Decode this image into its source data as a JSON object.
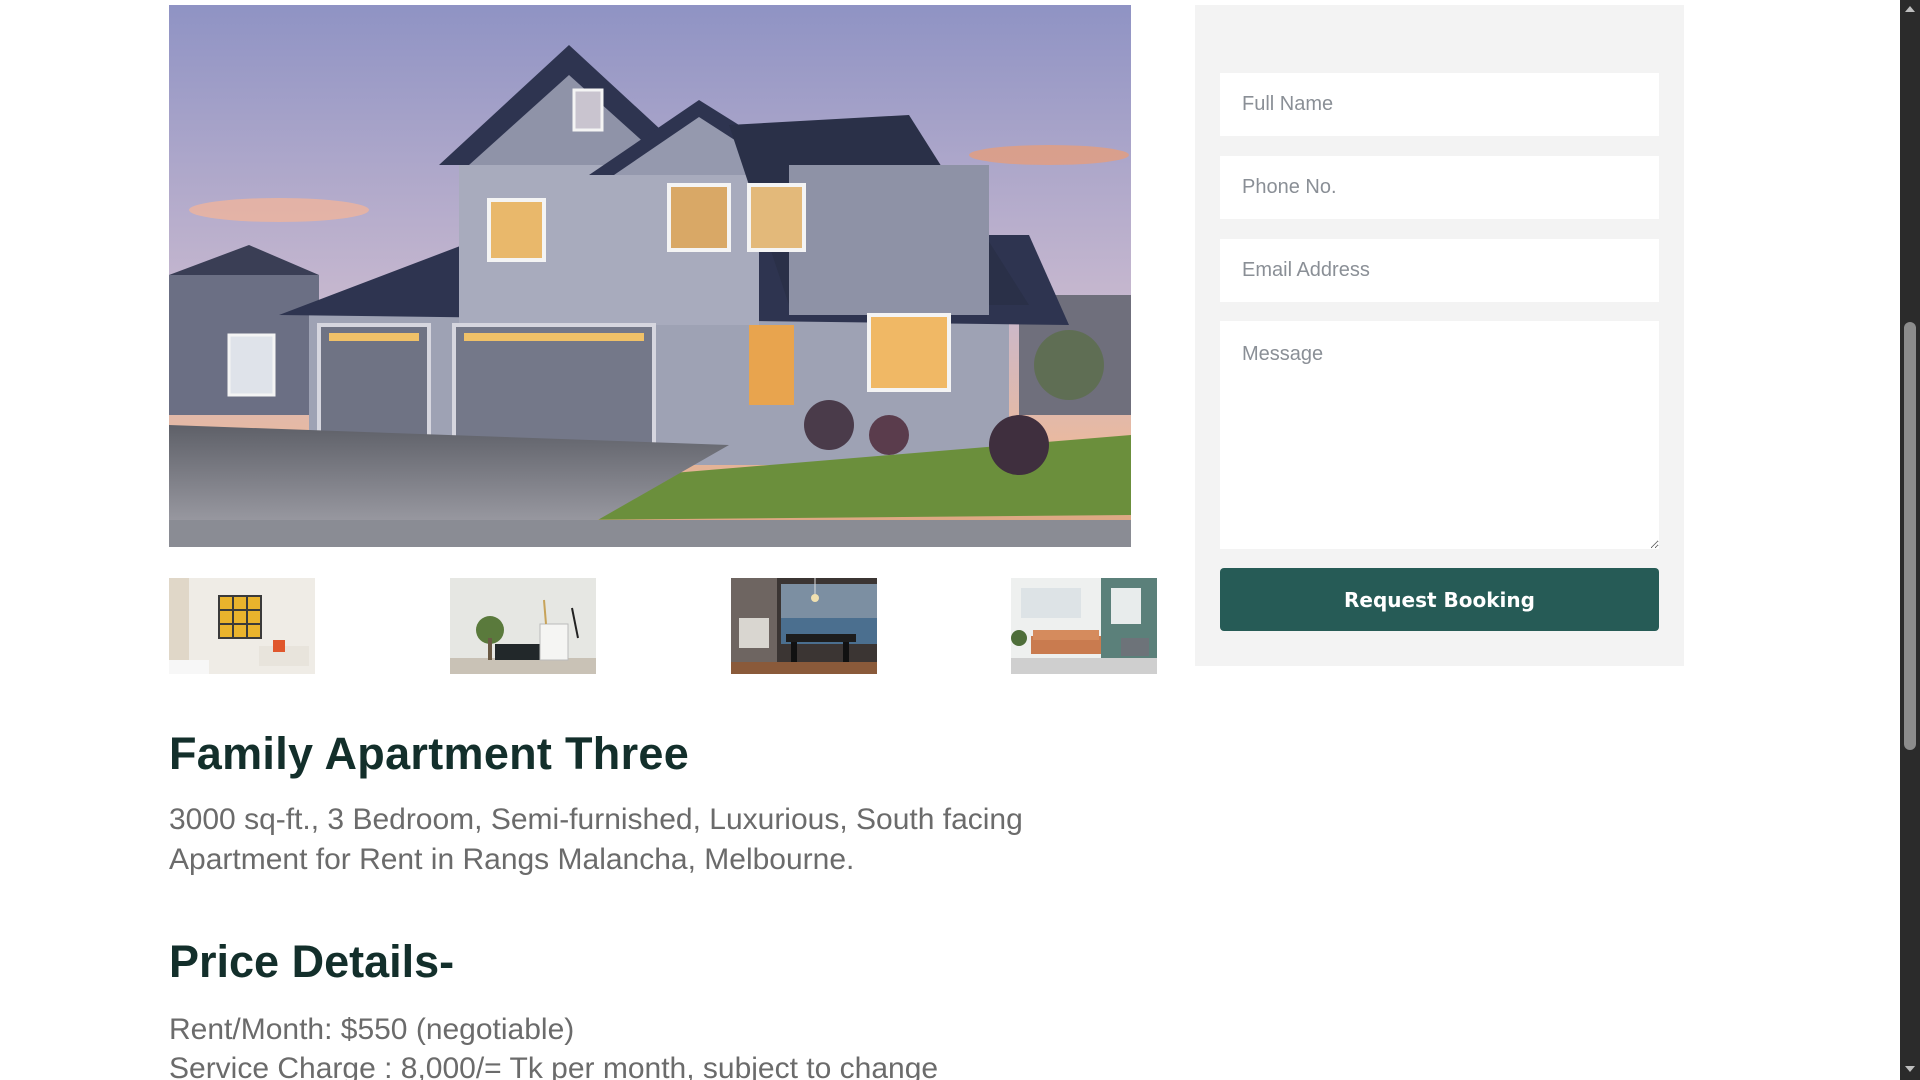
{
  "gallery": {
    "main_image_alt": "",
    "thumbnails": [
      {
        "icon": "living-room-photo"
      },
      {
        "icon": "lounge-photo"
      },
      {
        "icon": "dining-room-photo"
      },
      {
        "icon": "open-living-photo"
      }
    ]
  },
  "listing": {
    "title": "Family Apartment Three",
    "description_line1": "3000 sq-ft., 3 Bedroom, Semi-furnished, Luxurious, South facing",
    "description_line2": "Apartment for Rent in Rangs Malancha, Melbourne."
  },
  "price": {
    "heading": "Price Details-",
    "rent": "Rent/Month: $550 (negotiable)",
    "service_charge": "Service Charge : 8,000/= Tk per month, subject to change"
  },
  "booking_form": {
    "full_name_placeholder": "Full Name",
    "phone_placeholder": "Phone No.",
    "email_placeholder": "Email Address",
    "message_placeholder": "Message",
    "submit_label": "Request Booking"
  },
  "colors": {
    "accent": "#265b56",
    "heading": "#132f2b",
    "body_text": "#6b6b6b",
    "panel_bg": "#f3f3f3"
  },
  "scroll": {
    "position_fraction": 0.38
  }
}
